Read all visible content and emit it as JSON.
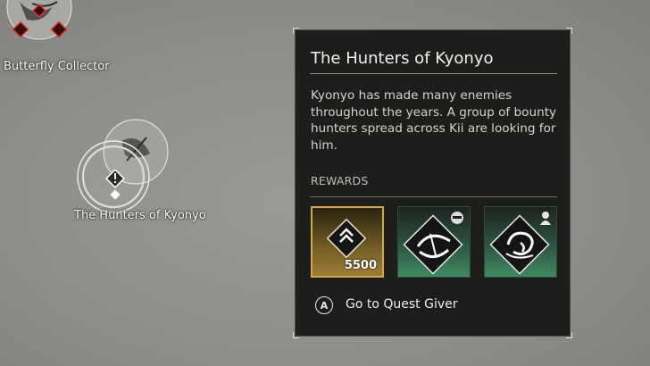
{
  "map": {
    "markers": [
      {
        "label": "Butterfly Collector"
      },
      {
        "label": "The Hunters of Kyonyo"
      }
    ]
  },
  "quest_panel": {
    "title": "The Hunters of Kyonyo",
    "description": "Kyonyo has made many enemies throughout the years. A group of bounty hunters spread across Kii are looking for him.",
    "rewards_heading": "REWARDS",
    "rewards": [
      {
        "icon": "chevron-up-xp-icon",
        "amount": "5500",
        "rarity_color": "#d2a94a"
      },
      {
        "icon": "sweep-technique-icon",
        "badge_icon": "oni-mask-icon",
        "rarity_color": "#3f8a62"
      },
      {
        "icon": "spiral-technique-icon",
        "badge_icon": "hooded-figure-icon",
        "rarity_color": "#3f8a62"
      }
    ],
    "action": {
      "button_glyph": "A",
      "label": "Go to Quest Giver"
    }
  }
}
